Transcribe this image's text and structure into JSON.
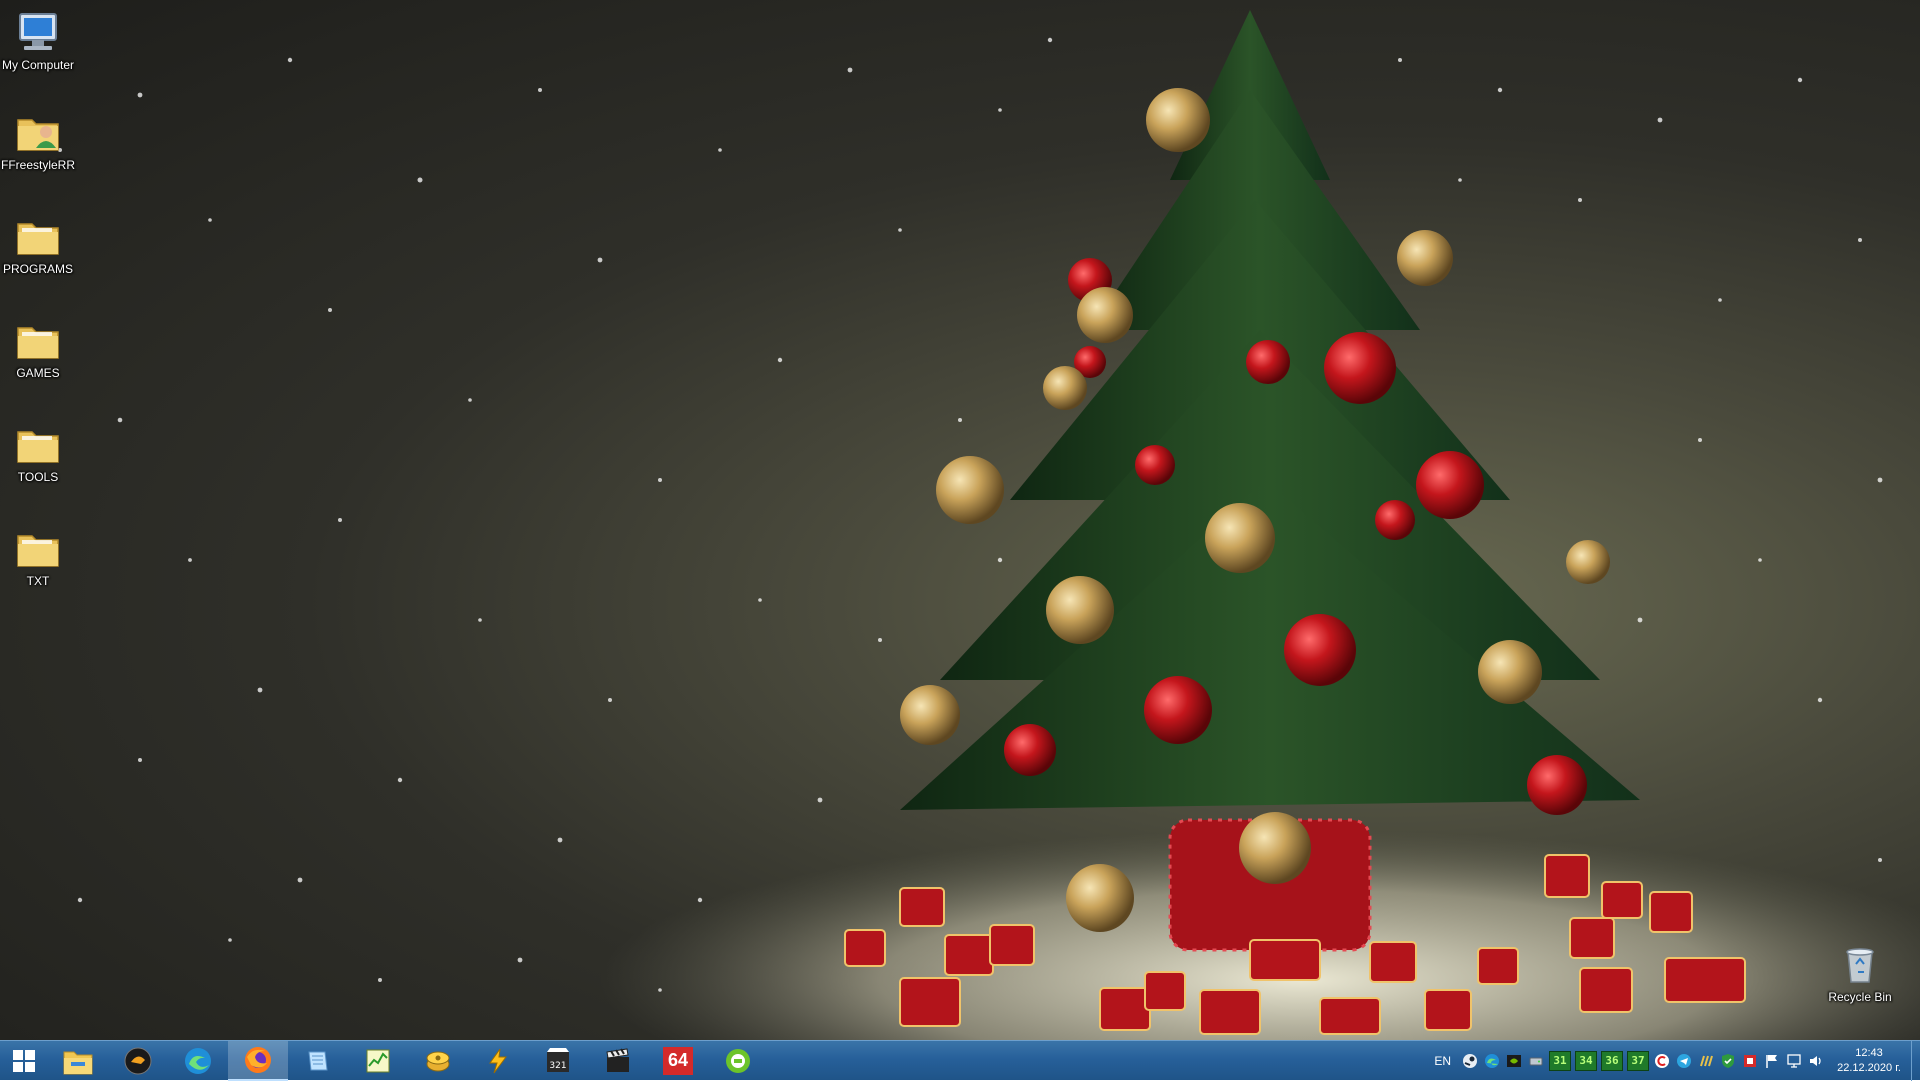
{
  "desktop_icons": [
    {
      "label": "My Computer",
      "icon": "computer-icon"
    },
    {
      "label": "FFreestyleRR",
      "icon": "user-folder-icon"
    },
    {
      "label": "PROGRAMS",
      "icon": "folder-icon"
    },
    {
      "label": "GAMES",
      "icon": "folder-icon"
    },
    {
      "label": "TOOLS",
      "icon": "folder-icon"
    },
    {
      "label": "TXT",
      "icon": "folder-icon"
    }
  ],
  "recycle_bin": {
    "label": "Recycle Bin",
    "icon": "recycle-bin-icon"
  },
  "taskbar": {
    "apps": [
      {
        "icon": "file-explorer-icon"
      },
      {
        "icon": "winamp-icon"
      },
      {
        "icon": "edge-icon"
      },
      {
        "icon": "firefox-icon",
        "active": true
      },
      {
        "icon": "notepad-icon"
      },
      {
        "icon": "task-manager-icon"
      },
      {
        "icon": "daemon-tools-icon"
      },
      {
        "icon": "aimp-icon"
      },
      {
        "icon": "media-player-classic-icon"
      },
      {
        "icon": "clapperboard-icon"
      },
      {
        "icon": "aida64-icon",
        "text": "64"
      },
      {
        "icon": "tray-app-icon"
      }
    ]
  },
  "tray": {
    "language": "EN",
    "temperatures": [
      "31",
      "34",
      "36",
      "37"
    ],
    "time": "12:43",
    "date": "22.12.2020 г."
  },
  "colors": {
    "taskbar": "#27609a",
    "ornament_red": "#c4161c",
    "ornament_gold": "#c9a35a",
    "tree_green": "#1f3d1f"
  }
}
